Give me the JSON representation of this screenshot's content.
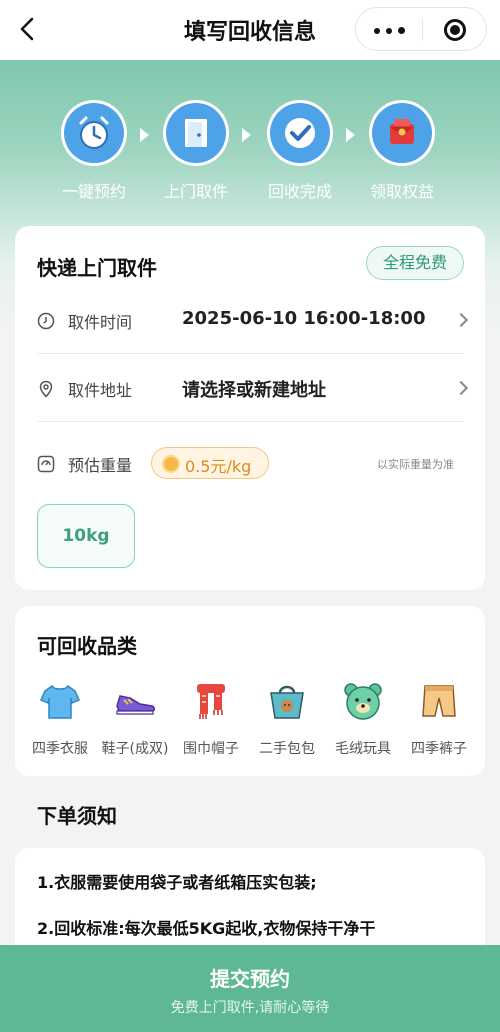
{
  "navbar": {
    "title": "填写回收信息",
    "back_icon": "chevron-left-icon",
    "more_icon": "more-dots-icon",
    "close_icon": "target-close-icon"
  },
  "steps": [
    {
      "label": "一键预约",
      "icon": "alarm-clock-icon"
    },
    {
      "label": "上门取件",
      "icon": "door-icon"
    },
    {
      "label": "回收完成",
      "icon": "check-badge-icon"
    },
    {
      "label": "领取权益",
      "icon": "red-envelope-icon"
    }
  ],
  "pickup": {
    "title": "快递上门取件",
    "badge": "全程免费",
    "time_label": "取件时间",
    "time_value": "2025-06-10 16:00-18:00",
    "address_label": "取件地址",
    "address_value": "请选择或新建地址",
    "weight_label": "预估重量",
    "price": "0.5元/kg",
    "weight_note": "以实际重量为准",
    "weight_option": "10kg"
  },
  "categories": {
    "title": "可回收品类",
    "items": [
      {
        "label": "四季衣服",
        "icon": "tshirt-icon"
      },
      {
        "label": "鞋子(成双)",
        "icon": "sneaker-icon"
      },
      {
        "label": "围巾帽子",
        "icon": "scarf-icon"
      },
      {
        "label": "二手包包",
        "icon": "handbag-icon"
      },
      {
        "label": "毛绒玩具",
        "icon": "plush-bear-icon"
      },
      {
        "label": "四季裤子",
        "icon": "pants-icon"
      }
    ]
  },
  "notice": {
    "title": "下单须知",
    "p1": "1.衣服需要使用袋子或者纸箱压实包装;",
    "p2": "2.回收标准:每次最低5KG起收,衣物保持干净干"
  },
  "submit": {
    "main": "提交预约",
    "sub": "免费上门取件,请耐心等待"
  },
  "colors": {
    "brand_green": "#5fb894",
    "step_blue": "#4ea2e8",
    "price_orange": "#e08a1e"
  }
}
